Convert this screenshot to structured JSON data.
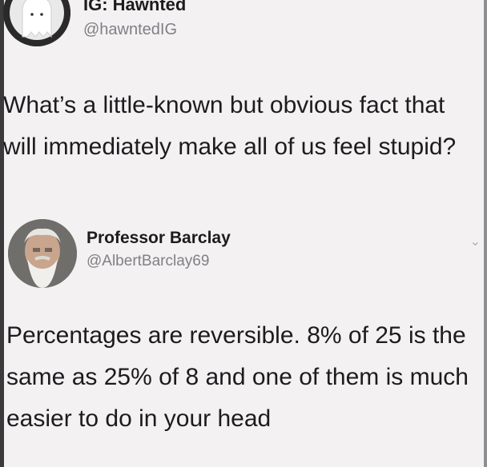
{
  "tweet_1": {
    "name": "IG: Hawnted",
    "handle": "@hawntedIG",
    "text": "What’s a little-known but obvious fact that will immediately make all of us feel stupid?"
  },
  "tweet_2": {
    "name": "Professor Barclay",
    "handle": "@AlbertBarclay69",
    "text": "Percentages are reversible.  8% of 25 is the same as 25% of 8 and one of them is much easier to do in your head"
  },
  "icons": {
    "menu": "chevron-down-icon"
  }
}
